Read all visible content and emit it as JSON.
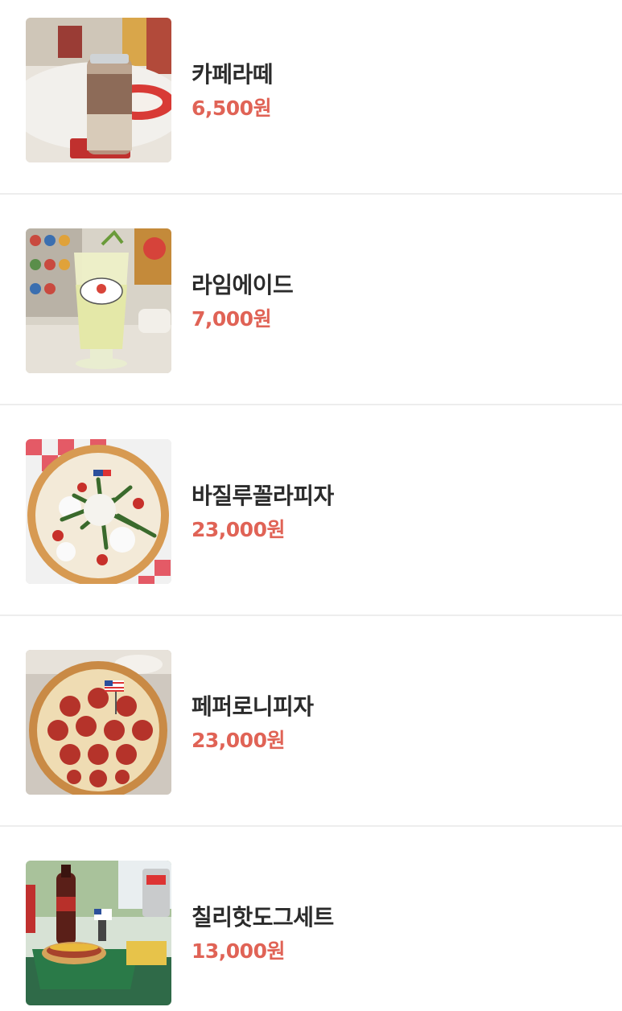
{
  "menu": {
    "items": [
      {
        "name": "카페라떼",
        "price": "6,500원",
        "photo": "cafe-latte-photo"
      },
      {
        "name": "라임에이드",
        "price": "7,000원",
        "photo": "limeade-photo"
      },
      {
        "name": "바질루꼴라피자",
        "price": "23,000원",
        "photo": "basil-arugula-pizza-photo"
      },
      {
        "name": "페퍼로니피자",
        "price": "23,000원",
        "photo": "pepperoni-pizza-photo"
      },
      {
        "name": "칠리핫도그세트",
        "price": "13,000원",
        "photo": "chili-hotdog-set-photo"
      }
    ]
  },
  "colors": {
    "price": "#e06356",
    "name": "#2b2b2b",
    "divider": "#ededed"
  }
}
